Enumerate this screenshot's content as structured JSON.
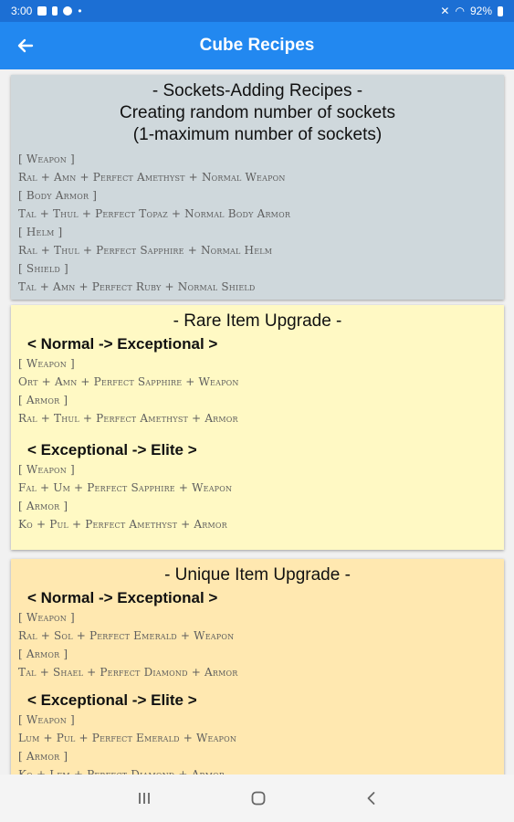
{
  "status_bar": {
    "time": "3:00",
    "battery": "92%"
  },
  "app_bar": {
    "title": "Cube Recipes"
  },
  "cards": [
    {
      "title_lines": [
        "- Sockets-Adding Recipes -",
        "Creating random number of sockets",
        "(1-maximum number of sockets)"
      ],
      "lines": [
        "[ Weapon ]",
        "Ral + Amn + Perfect Amethyst + Normal Weapon",
        "[ Body Armor ]",
        "Tal + Thul + Perfect Topaz + Normal Body Armor",
        "[ Helm ]",
        "Ral + Thul + Perfect Sapphire + Normal Helm",
        "[ Shield ]",
        "Tal + Amn + Perfect Ruby + Normal Shield"
      ]
    },
    {
      "title": "- Rare Item Upgrade -",
      "sections": [
        {
          "heading": "< Normal -> Exceptional >",
          "lines": [
            "[ Weapon ]",
            "Ort + Amn + Perfect Sapphire + Weapon",
            "[ Armor ]",
            "Ral + Thul + Perfect Amethyst + Armor"
          ]
        },
        {
          "heading": "< Exceptional -> Elite >",
          "lines": [
            "[ Weapon ]",
            "Fal + Um + Perfect Sapphire + Weapon",
            "[ Armor ]",
            "Ko + Pul + Perfect Amethyst + Armor"
          ]
        }
      ]
    },
    {
      "title": "- Unique Item Upgrade -",
      "sections": [
        {
          "heading": "< Normal -> Exceptional >",
          "lines": [
            "[ Weapon ]",
            "Ral + Sol + Perfect Emerald + Weapon",
            "[ Armor ]",
            "Tal + Shael + Perfect Diamond + Armor"
          ]
        },
        {
          "heading": "< Exceptional -> Elite >",
          "lines": [
            "[ Weapon ]",
            "Lum + Pul + Perfect Emerald + Weapon",
            "[ Armor ]",
            "Ko + Lem + Perfect Diamond + Armor"
          ]
        }
      ]
    }
  ],
  "icons": {
    "back": "arrow-left-icon",
    "nav_recents": "recents-icon",
    "nav_home": "home-icon",
    "nav_back": "back-icon"
  },
  "colors": {
    "status_bar": "#1c6fd4",
    "app_bar": "#2288f0",
    "card_gray": "#cfd8dc",
    "card_yellow": "#fff9c4",
    "card_orange": "#ffe8b0"
  }
}
